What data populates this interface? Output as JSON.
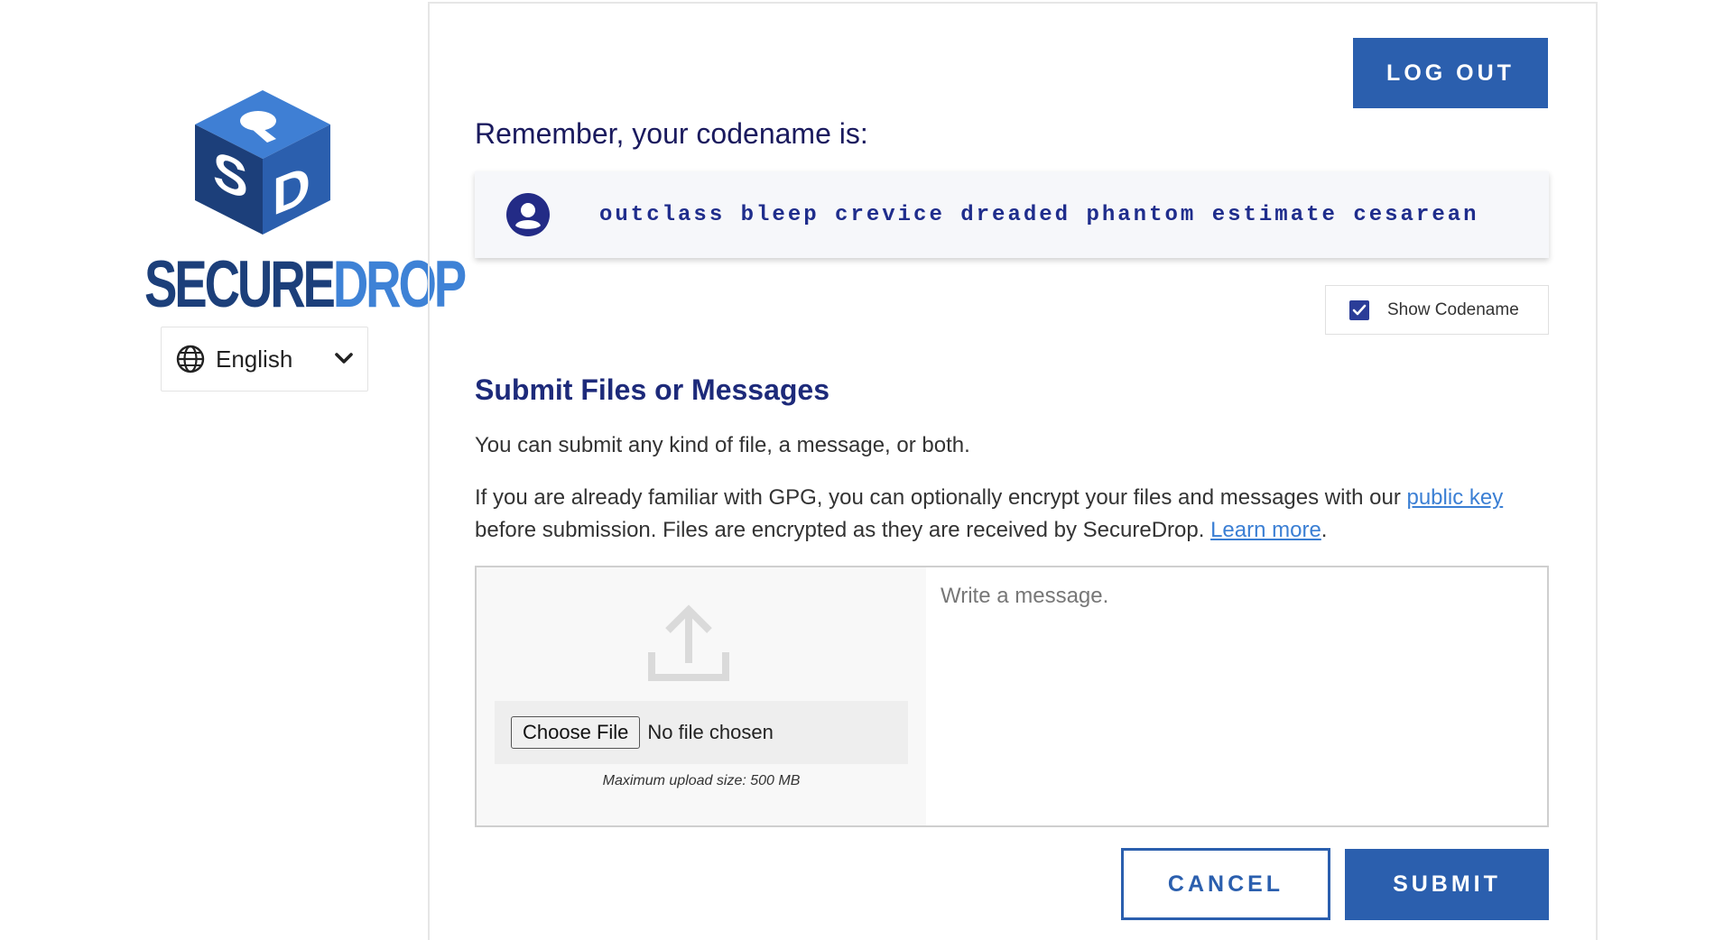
{
  "sidebar": {
    "logo_word_1": "SECURE",
    "logo_word_2": "DROP",
    "language": {
      "label": "English",
      "icon": "globe-icon",
      "chevron": "chevron-down-icon"
    }
  },
  "header": {
    "logout_label": "LOG OUT"
  },
  "codename": {
    "heading": "Remember, your codename is:",
    "value": "outclass bleep crevice dreaded phantom estimate cesarean",
    "icon": "user-icon",
    "show_label": "Show Codename",
    "show_checked": true
  },
  "submit_section": {
    "title": "Submit Files or Messages",
    "intro": "You can submit any kind of file, a message, or both.",
    "gpg_text_1": "If you are already familiar with GPG, you can optionally encrypt your files and messages with our ",
    "public_key_link": "public key",
    "gpg_text_2": " before submission. Files are encrypted as they are received by SecureDrop. ",
    "learn_more_link": "Learn more",
    "gpg_text_3": ".",
    "upload_icon": "upload-icon",
    "choose_file_label": "Choose File",
    "no_file_text": "No file chosen",
    "max_upload": "Maximum upload size: 500 MB",
    "message_placeholder": "Write a message.",
    "cancel_label": "CANCEL",
    "submit_label": "SUBMIT"
  },
  "colors": {
    "primary": "#2b5fae",
    "heading": "#1d2a7a",
    "link": "#3b7fd4",
    "codename_text": "#1f2d8c",
    "logo_dark": "#1c3f7a",
    "logo_light": "#3e82d6"
  }
}
